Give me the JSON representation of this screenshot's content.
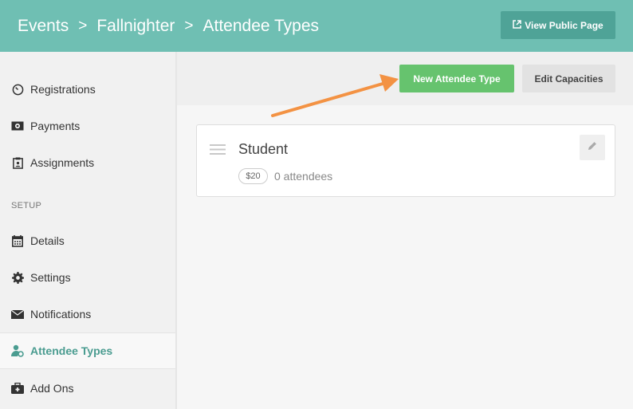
{
  "header": {
    "breadcrumb": [
      "Events",
      "Fallnighter",
      "Attendee Types"
    ],
    "separator": ">",
    "view_public_label": "View Public Page"
  },
  "sidebar": {
    "items": [
      {
        "label": "Registrations",
        "icon": "speedometer-icon"
      },
      {
        "label": "Payments",
        "icon": "money-icon"
      },
      {
        "label": "Assignments",
        "icon": "assignment-icon"
      }
    ],
    "setup_label": "SETUP",
    "setup_items": [
      {
        "label": "Details",
        "icon": "calendar-icon"
      },
      {
        "label": "Settings",
        "icon": "gear-icon"
      },
      {
        "label": "Notifications",
        "icon": "envelope-icon"
      },
      {
        "label": "Attendee Types",
        "icon": "attendee-icon",
        "active": true
      },
      {
        "label": "Add Ons",
        "icon": "medkit-icon"
      }
    ]
  },
  "toolbar": {
    "new_label": "New Attendee Type",
    "capacities_label": "Edit Capacities"
  },
  "attendee_types": [
    {
      "name": "Student",
      "price": "$20",
      "count_label": "0 attendees"
    }
  ],
  "colors": {
    "header": "#6fbfb3",
    "primary_button": "#4fa397",
    "new_button": "#66c36e",
    "active_nav": "#4a9c90",
    "arrow": "#f39243"
  }
}
